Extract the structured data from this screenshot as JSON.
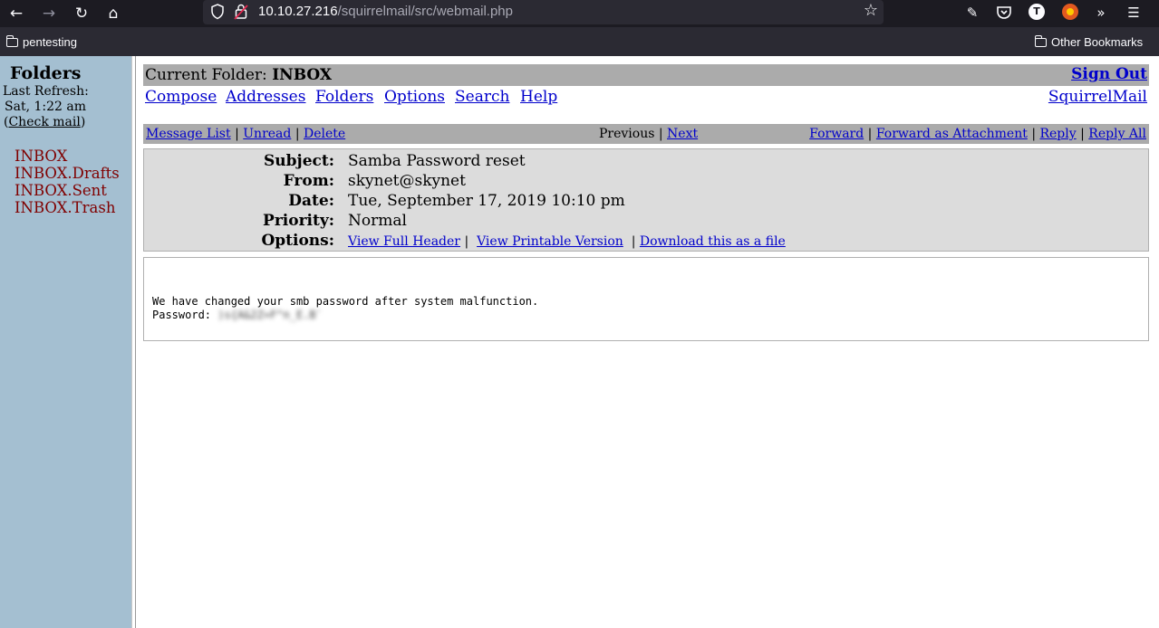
{
  "browser": {
    "url_host": "10.10.27.216",
    "url_path": "/squirrelmail/src/webmail.php",
    "profile_initial": "T",
    "bookmarks": {
      "left": "pentesting",
      "right": "Other Bookmarks"
    }
  },
  "sidebar": {
    "title": "Folders",
    "refresh_label": "Last Refresh:",
    "refresh_time": "Sat, 1:22 am",
    "check_mail_open": "(",
    "check_mail": "Check mail",
    "check_mail_close": ")",
    "folders": [
      "INBOX",
      "INBOX.Drafts",
      "INBOX.Sent",
      "INBOX.Trash"
    ]
  },
  "main": {
    "current_folder_label": "Current Folder:",
    "current_folder": "INBOX",
    "sign_out": "Sign Out",
    "menu": [
      "Compose",
      "Addresses",
      "Folders",
      "Options",
      "Search",
      "Help"
    ],
    "brand": "SquirrelMail",
    "msgnav": {
      "message_list": "Message List",
      "unread": "Unread",
      "delete": "Delete",
      "previous": "Previous",
      "next": "Next",
      "forward": "Forward",
      "forward_attachment": "Forward as Attachment",
      "reply": "Reply",
      "reply_all": "Reply All",
      "sep": "|"
    },
    "headers": {
      "subject_label": "Subject:",
      "subject": "Samba Password reset",
      "from_label": "From:",
      "from": "skynet@skynet",
      "date_label": "Date:",
      "date": "Tue, September 17, 2019 10:10 pm",
      "priority_label": "Priority:",
      "priority": "Normal",
      "options_label": "Options:",
      "view_full_header": "View Full Header",
      "view_printable": "View Printable Version",
      "download": "Download this as a file"
    },
    "body": {
      "line1": "We have changed your smb password after system malfunction.",
      "password_label": "Password:",
      "password_value": ")s{A&2Z=F^n_E.B`"
    }
  }
}
